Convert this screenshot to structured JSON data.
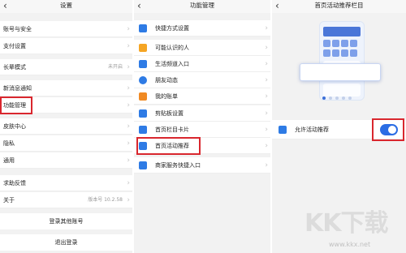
{
  "settings": {
    "title": "设置",
    "back": "‹",
    "items": [
      {
        "label": "账号与安全",
        "value": ""
      },
      {
        "label": "支付设置",
        "value": ""
      },
      {
        "label": "长辈模式",
        "value": "未开启"
      },
      {
        "label": "新消息通知",
        "value": ""
      },
      {
        "label": "功能管理",
        "value": ""
      },
      {
        "label": "皮肤中心",
        "value": ""
      },
      {
        "label": "隐私",
        "value": ""
      },
      {
        "label": "通用",
        "value": ""
      },
      {
        "label": "求助反馈",
        "value": ""
      },
      {
        "label": "关于",
        "value": "版本号 10.2.58"
      }
    ],
    "switch_account": "登录其他账号",
    "logout": "退出登录"
  },
  "func_mgmt": {
    "title": "功能管理",
    "back": "‹",
    "items": [
      {
        "label": "快捷方式设置",
        "icon": "shortcut-icon",
        "color": "#2e7be5"
      },
      {
        "label": "可能认识的人",
        "icon": "contacts-icon",
        "color": "#f5a524"
      },
      {
        "label": "生活频道入口",
        "icon": "life-channel-icon",
        "color": "#2e7be5"
      },
      {
        "label": "朋友动态",
        "icon": "moments-icon",
        "color": "#2e7be5"
      },
      {
        "label": "我的账单",
        "icon": "bill-icon",
        "color": "#f08a24"
      },
      {
        "label": "剪贴板设置",
        "icon": "clipboard-icon",
        "color": "#2e7be5"
      },
      {
        "label": "首页栏目卡片",
        "icon": "cards-icon",
        "color": "#2e7be5"
      },
      {
        "label": "首页活动推荐",
        "icon": "activity-icon",
        "color": "#2e7be5"
      },
      {
        "label": "商家服务快捷入口",
        "icon": "merchant-icon",
        "color": "#2e7be5"
      }
    ]
  },
  "recommend": {
    "title": "首页活动推荐栏目",
    "back": "‹",
    "toggle_label": "允许活动推荐",
    "toggle_on": true,
    "accent": "#2b6de4"
  },
  "watermark": {
    "brand": "KK下载",
    "url": "www.kkx.net"
  },
  "highlight_color": "#d9272e"
}
